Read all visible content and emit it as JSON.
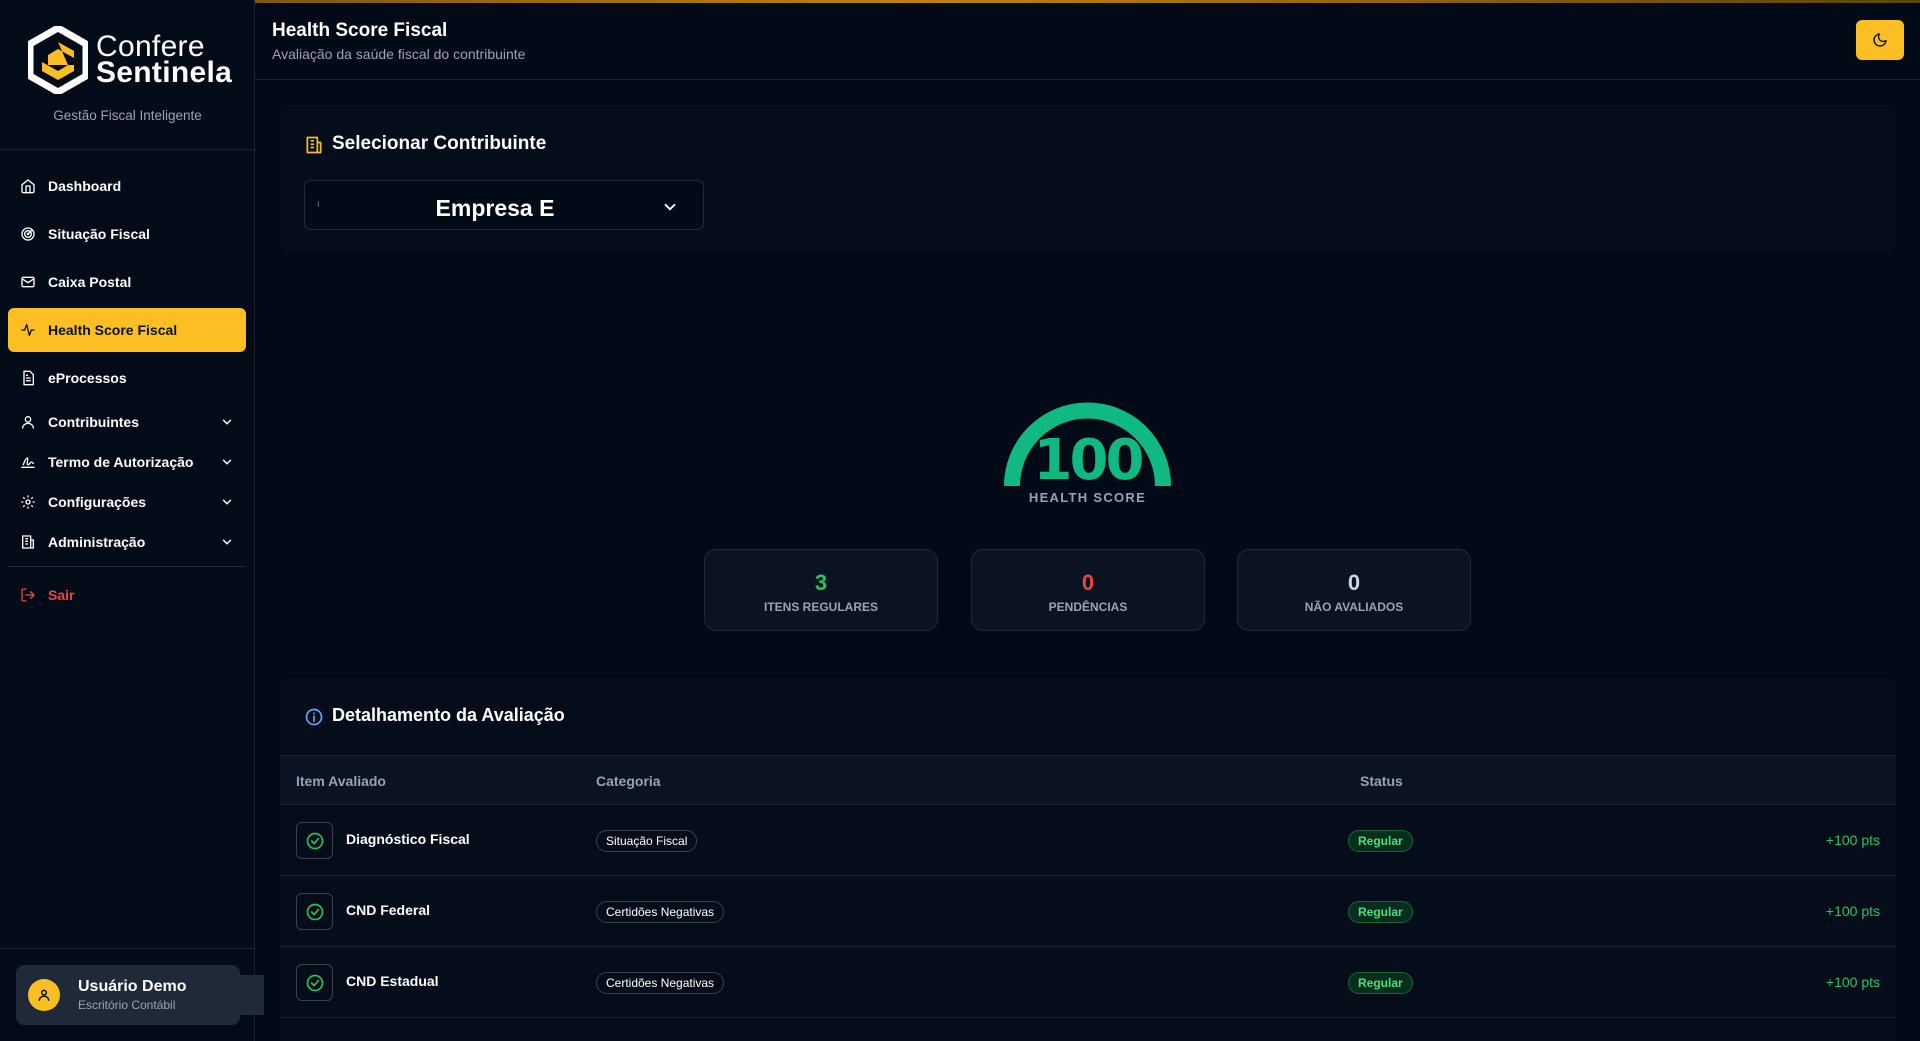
{
  "brand": {
    "name_line1": "Confere",
    "name_line2": "Sentinela",
    "tagline": "Gestão Fiscal Inteligente",
    "accent_color": "#fbbf24"
  },
  "sidebar": {
    "items": [
      {
        "label": "Dashboard",
        "icon": "home-icon"
      },
      {
        "label": "Situação Fiscal",
        "icon": "radar-icon"
      },
      {
        "label": "Caixa Postal",
        "icon": "mail-icon"
      },
      {
        "label": "Health Score Fiscal",
        "icon": "activity-icon",
        "active": true
      },
      {
        "label": "eProcessos",
        "icon": "file-text-icon"
      },
      {
        "label": "Contribuintes",
        "icon": "user-icon",
        "expandable": true
      },
      {
        "label": "Termo de Autorização",
        "icon": "signature-icon",
        "expandable": true
      },
      {
        "label": "Configurações",
        "icon": "gear-icon",
        "expandable": true
      },
      {
        "label": "Administração",
        "icon": "building-icon",
        "expandable": true
      }
    ],
    "logout_label": "Sair"
  },
  "user": {
    "name": "Usuário Demo",
    "role": "Escritório Contábil"
  },
  "header": {
    "title": "Health Score Fiscal",
    "subtitle": "Avaliação da saúde fiscal do contribuinte"
  },
  "selector": {
    "title": "Selecionar Contribuinte",
    "selected": "Empresa E"
  },
  "score": {
    "value": "100",
    "label": "HEALTH SCORE",
    "fraction": 1.0,
    "color": "#10b981"
  },
  "stats": [
    {
      "value": "3",
      "label": "ITENS REGULARES",
      "color": "#22c55e"
    },
    {
      "value": "0",
      "label": "PENDÊNCIAS",
      "color": "#ef4444"
    },
    {
      "value": "0",
      "label": "NÃO AVALIADOS",
      "color": "#cbd5e1"
    }
  ],
  "details": {
    "title": "Detalhamento da Avaliação",
    "columns": [
      "Item Avaliado",
      "Categoria",
      "Status"
    ],
    "rows": [
      {
        "item": "Diagnóstico Fiscal",
        "category": "Situação Fiscal",
        "status": "Regular",
        "points": "+100 pts"
      },
      {
        "item": "CND Federal",
        "category": "Certidões Negativas",
        "status": "Regular",
        "points": "+100 pts"
      },
      {
        "item": "CND Estadual",
        "category": "Certidões Negativas",
        "status": "Regular",
        "points": "+100 pts"
      }
    ]
  }
}
